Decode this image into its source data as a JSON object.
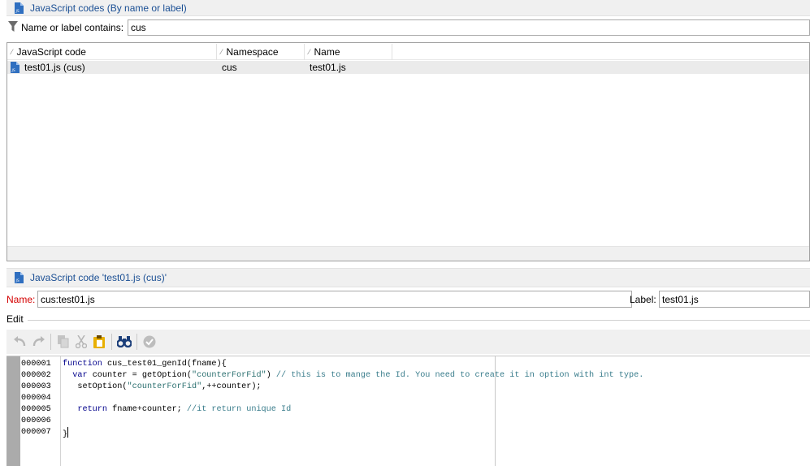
{
  "search_panel": {
    "title": "JavaScript codes (By name or label)",
    "icon": "js-file-icon"
  },
  "filter": {
    "label": "Name or label contains:",
    "value": "cus",
    "icon": "filter-funnel-icon"
  },
  "list": {
    "columns": [
      "JavaScript code",
      "Namespace",
      "Name"
    ],
    "rows": [
      {
        "code": "test01.js (cus)",
        "namespace": "cus",
        "name": "test01.js"
      }
    ]
  },
  "detail_panel": {
    "title": "JavaScript code 'test01.js (cus)'",
    "icon": "js-file-icon"
  },
  "fields": {
    "name_label": "Name:",
    "name_value": "cus:test01.js",
    "label_label": "Label:",
    "label_value": "test01.js"
  },
  "edit_section": {
    "legend": "Edit"
  },
  "toolbar": {
    "buttons": [
      "undo-icon",
      "redo-icon",
      "copy-icon",
      "cut-icon",
      "paste-icon",
      "find-binoculars-icon",
      "check-icon"
    ]
  },
  "editor": {
    "line_numbers": [
      "000001",
      "000002",
      "000003",
      "000004",
      "000005",
      "000006",
      "000007"
    ],
    "lines": [
      "function cus_test01_genId(fname){",
      "  var counter = getOption(\"counterForFid\") // this is to mange the Id. You need to create it in option with int type.",
      "   setOption(\"counterForFid\",++counter);",
      "",
      "   return fname+counter; //it return unique Id",
      "",
      "}"
    ]
  },
  "colors": {
    "panel_title": "#1b4f94",
    "required_label": "#d40000",
    "keyword": "#00008b",
    "string": "#2a6f6f",
    "comment": "#3a7d8c"
  }
}
